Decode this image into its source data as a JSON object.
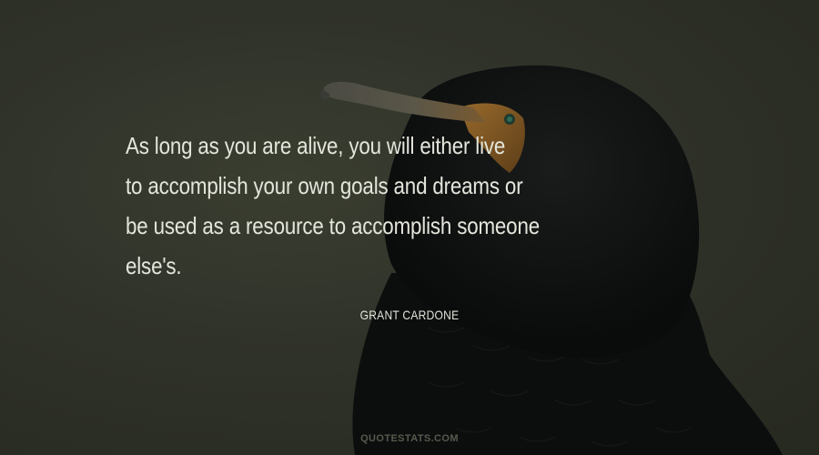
{
  "quote": {
    "lines": [
      "As long as you are alive, you will either live",
      "to accomplish your own goals and dreams or",
      "be used as a resource to accomplish someone",
      "else's."
    ]
  },
  "author": "Grant Cardone",
  "watermark": "quotestats.com",
  "colors": {
    "background": "#2f3228",
    "text": "#e4e6dc",
    "bird_body": "#0d0f0f",
    "beak_orange": "#a06a28"
  }
}
